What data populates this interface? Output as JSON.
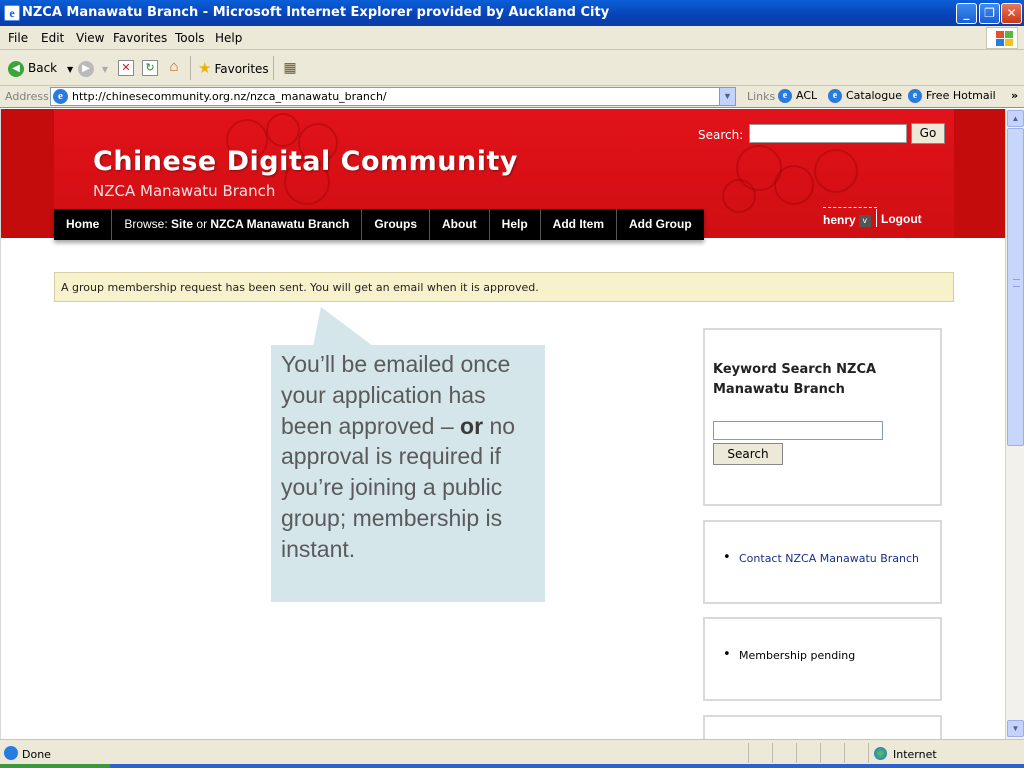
{
  "window": {
    "title": "NZCA Manawatu Branch - Microsoft Internet Explorer provided by Auckland City",
    "min_glyph": "_",
    "max_glyph": "❐",
    "close_glyph": "✕"
  },
  "menu": [
    "File",
    "Edit",
    "View",
    "Favorites",
    "Tools",
    "Help"
  ],
  "toolbar": {
    "back_label": "Back",
    "favorites_label": "Favorites"
  },
  "address": {
    "label": "Address",
    "url": "http://chinesecommunity.org.nz/nzca_manawatu_branch/",
    "links_label": "Links",
    "links": [
      "ACL",
      "Catalogue",
      "Free Hotmail"
    ],
    "more": "»"
  },
  "site": {
    "title": "Chinese Digital Community",
    "subtitle": "NZCA Manawatu Branch",
    "search_label": "Search:",
    "go_label": "Go"
  },
  "nav": {
    "home": "Home",
    "browse_prefix": "Browse:",
    "browse_site": "Site",
    "browse_or": "or",
    "browse_branch": "NZCA Manawatu Branch",
    "groups": "Groups",
    "about": "About",
    "help": "Help",
    "add_item": "Add Item",
    "add_group": "Add Group"
  },
  "user": {
    "name": "henry",
    "badge": "v",
    "logout": "Logout"
  },
  "notice": "A group membership request has been sent. You will get an email when it is approved.",
  "callout": {
    "line_before": "You’ll be emailed once your application has been approved –",
    "bold": "or",
    "line_after": "no approval is required if you’re joining a public group; membership is instant."
  },
  "sidebar": {
    "keyword_title": "Keyword Search NZCA Manawatu Branch",
    "search_button": "Search",
    "contact_link": "Contact NZCA Manawatu Branch",
    "membership_status": "Membership pending"
  },
  "status": {
    "text": "Done",
    "zone": "Internet"
  }
}
